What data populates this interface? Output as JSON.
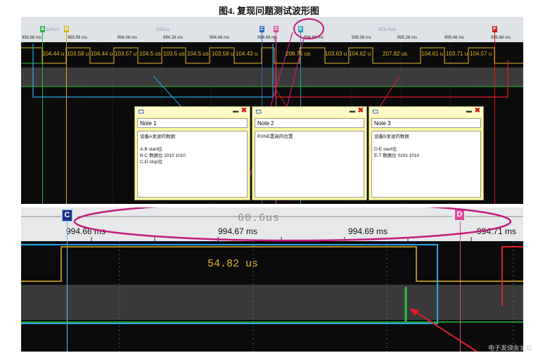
{
  "figure_title": "图4. 复现问题测试波形图",
  "top_view": {
    "ruler_ticks": [
      "993.88 ms",
      "993.98 ms",
      "994.08 ms",
      "994.28 ms",
      "994.48 ms",
      "994.68 ms",
      "994.88 ms",
      "995.08 ms",
      "995.28 ms",
      "995.48 ms",
      "995.68 ms"
    ],
    "measurements": [
      "104us",
      "832us",
      "828.8us"
    ],
    "cursor_labels": [
      "A",
      "B",
      "C",
      "D",
      "E",
      "F"
    ],
    "segment_values_group_a": [
      "104.44 u",
      "103.58 u",
      "104.44 u",
      "103.57 u",
      "104.5 us",
      "103.5 us",
      "104.5 us",
      "103.58 u",
      "104.43 u"
    ],
    "segment_values_group_b": [
      "208.75 us",
      "103.63 u",
      "104.62 u",
      "207.82 us",
      "104.61 u",
      "103.71 u",
      "104.57 u"
    ]
  },
  "notes": [
    {
      "title": "Note 1",
      "body": "设备A发送的数据:\n\nA-B start位\nB-C 数据位 1010 1010\nC-D stop位"
    },
    {
      "title": "Note 2",
      "body": "RXNE置高的位置"
    },
    {
      "title": "Note 3",
      "body": "设备B发送的数据\n\nD-E start位\nE-T 数据位 0101 1010"
    }
  ],
  "bottom_view": {
    "measurement": "60.6us",
    "segment_value": "54.82 us",
    "ruler_ticks": [
      "994.66 ms",
      "994.67 ms",
      "994.69 ms",
      "994.71 ms"
    ],
    "cursor_labels": [
      "C",
      "D"
    ]
  },
  "watermark": "电子发烧友论坛",
  "colors": {
    "blue_frame": "#2aa6e6",
    "red_frame": "#e0202a",
    "yellow_signal": "#e7b52a",
    "green_signal": "#24c33a",
    "magenta_annotation": "#c21a7c"
  }
}
